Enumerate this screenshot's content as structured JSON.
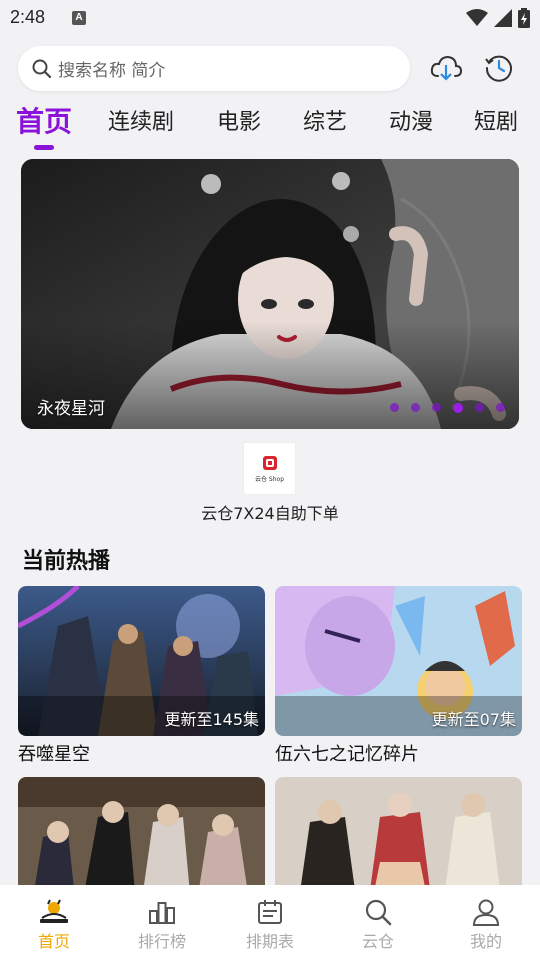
{
  "status": {
    "time": "2:48",
    "notif_badge": "A"
  },
  "search": {
    "placeholder": "搜索名称 简介",
    "icon": "search-icon"
  },
  "header_icons": [
    "cloud-download-icon",
    "history-icon"
  ],
  "tabs": [
    {
      "label": "首页",
      "active": true
    },
    {
      "label": "连续剧"
    },
    {
      "label": "电影"
    },
    {
      "label": "综艺"
    },
    {
      "label": "动漫"
    },
    {
      "label": "短剧"
    }
  ],
  "banner": {
    "title": "永夜星河",
    "slide_count": 6,
    "active_slide": 4
  },
  "ad": {
    "logo_text": "云仓 Shop",
    "text": "云仓7X24自助下单"
  },
  "section": {
    "title": "当前热播"
  },
  "cards": [
    {
      "title": "吞噬星空",
      "update": "更新至145集"
    },
    {
      "title": "伍六七之记忆碎片",
      "update": "更新至07集"
    },
    {
      "title": "",
      "update": ""
    },
    {
      "title": "",
      "update": ""
    }
  ],
  "bottom_nav": [
    {
      "label": "首页",
      "icon": "home-logo-icon",
      "active": true
    },
    {
      "label": "排行榜",
      "icon": "ranking-icon"
    },
    {
      "label": "排期表",
      "icon": "schedule-icon"
    },
    {
      "label": "云仓",
      "icon": "search-icon"
    },
    {
      "label": "我的",
      "icon": "user-icon"
    }
  ],
  "colors": {
    "accent": "#8b12d8",
    "nav_active": "#f0a800",
    "background": "#f2f2f5"
  }
}
